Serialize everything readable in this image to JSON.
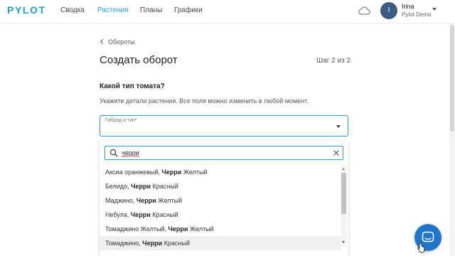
{
  "header": {
    "logo": "PYLOT",
    "nav": [
      "Сводка",
      "Растения",
      "Планы",
      "Графики"
    ],
    "active_nav": "Растения",
    "user": {
      "initial": "I",
      "name": "Irina",
      "org": "Pylot Demo"
    }
  },
  "main": {
    "back_label": "Обороты",
    "title": "Создать оборот",
    "step": "Шаг 2 из  2",
    "question": "Какой тип томата?",
    "hint": "Укажите детали растения. Все поля можно изменить в любой момент.",
    "select_label": "Гибрид и тип*"
  },
  "dropdown": {
    "search_value": "черри",
    "options": [
      {
        "prefix": "Аксиа оранжевый, ",
        "bold": "Черри",
        "suffix": " Желтый"
      },
      {
        "prefix": "Белидо, ",
        "bold": "Черри",
        "suffix": " Красный"
      },
      {
        "prefix": "Маджино, ",
        "bold": "Черри",
        "suffix": " Желтый"
      },
      {
        "prefix": "Небула, ",
        "bold": "Черри",
        "suffix": " Красный"
      },
      {
        "prefix": "Томаджино Желтый, ",
        "bold": "Черри",
        "suffix": " Желтый"
      },
      {
        "prefix": "Томаджино, ",
        "bold": "Черри",
        "suffix": " Красный"
      }
    ],
    "hovered_index": 5
  },
  "colors": {
    "accent": "#1d9fd6",
    "avatar": "#3d5a80",
    "chat": "#1f75c9"
  },
  "icons": [
    "cloud-icon",
    "chevron-left-icon",
    "caret-down-icon",
    "search-icon",
    "clear-icon",
    "chat-icon",
    "cursor-icon"
  ]
}
